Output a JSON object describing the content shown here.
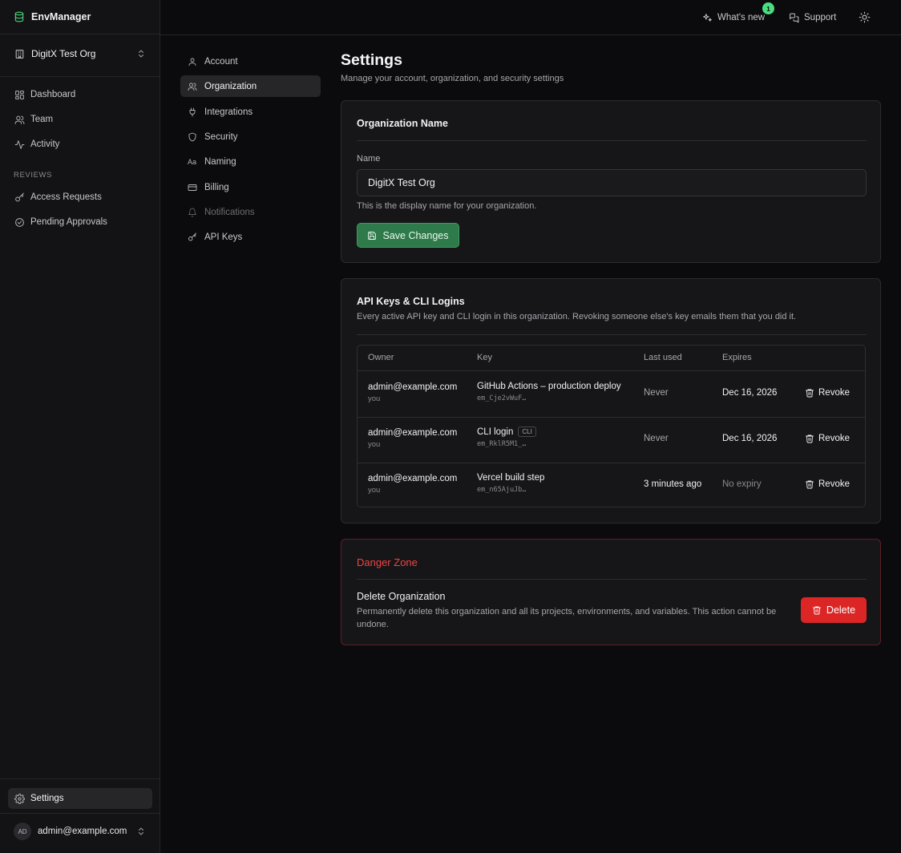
{
  "app": {
    "name": "EnvManager"
  },
  "org_switcher": {
    "name": "DigitX Test Org"
  },
  "sidebar": {
    "items": [
      {
        "label": "Dashboard"
      },
      {
        "label": "Team"
      },
      {
        "label": "Activity"
      }
    ],
    "reviews_label": "REVIEWS",
    "review_items": [
      {
        "label": "Access Requests"
      },
      {
        "label": "Pending Approvals"
      }
    ],
    "settings_label": "Settings",
    "user": {
      "initials": "AD",
      "email": "admin@example.com"
    }
  },
  "topbar": {
    "whats_new": "What's new",
    "whats_new_badge": "1",
    "support": "Support"
  },
  "settings_nav": [
    {
      "label": "Account",
      "icon": "user-icon"
    },
    {
      "label": "Organization",
      "icon": "users-icon",
      "active": true
    },
    {
      "label": "Integrations",
      "icon": "plug-icon"
    },
    {
      "label": "Security",
      "icon": "shield-icon"
    },
    {
      "label": "Naming",
      "icon": "text-case-icon",
      "glyph": "Aa"
    },
    {
      "label": "Billing",
      "icon": "credit-card-icon"
    },
    {
      "label": "Notifications",
      "icon": "bell-icon",
      "disabled": true
    },
    {
      "label": "API Keys",
      "icon": "key-icon"
    }
  ],
  "page": {
    "title": "Settings",
    "subtitle": "Manage your account, organization, and security settings"
  },
  "org_name_card": {
    "title": "Organization Name",
    "field_label": "Name",
    "value": "DigitX Test Org",
    "hint": "This is the display name for your organization.",
    "save_label": "Save Changes"
  },
  "api_keys_card": {
    "title": "API Keys & CLI Logins",
    "description": "Every active API key and CLI login in this organization. Revoking someone else's key emails them that you did it.",
    "columns": {
      "owner": "Owner",
      "key": "Key",
      "last_used": "Last used",
      "expires": "Expires"
    },
    "rows": [
      {
        "owner": "admin@example.com",
        "owner_sub": "you",
        "key_name": "GitHub Actions – production deploy",
        "key_id": "em_Cje2vWuF…",
        "tag": "",
        "last_used": "Never",
        "expires": "Dec 16, 2026",
        "revoke": "Revoke"
      },
      {
        "owner": "admin@example.com",
        "owner_sub": "you",
        "key_name": "CLI login",
        "key_id": "em_RklR5M1_…",
        "tag": "CLI",
        "last_used": "Never",
        "expires": "Dec 16, 2026",
        "revoke": "Revoke"
      },
      {
        "owner": "admin@example.com",
        "owner_sub": "you",
        "key_name": "Vercel build step",
        "key_id": "em_n65AjuJb…",
        "tag": "",
        "last_used": "3 minutes ago",
        "expires": "No expiry",
        "revoke": "Revoke"
      }
    ]
  },
  "danger_card": {
    "title": "Danger Zone",
    "delete_title": "Delete Organization",
    "delete_desc": "Permanently delete this organization and all its projects, environments, and variables. This action cannot be undone.",
    "delete_label": "Delete"
  },
  "colors": {
    "accent_green": "#4ade80",
    "save_button": "#2f7a4a",
    "danger": "#ef4444",
    "delete_button": "#dc2626",
    "background": "#0b0b0d",
    "sidebar": "#131315"
  }
}
